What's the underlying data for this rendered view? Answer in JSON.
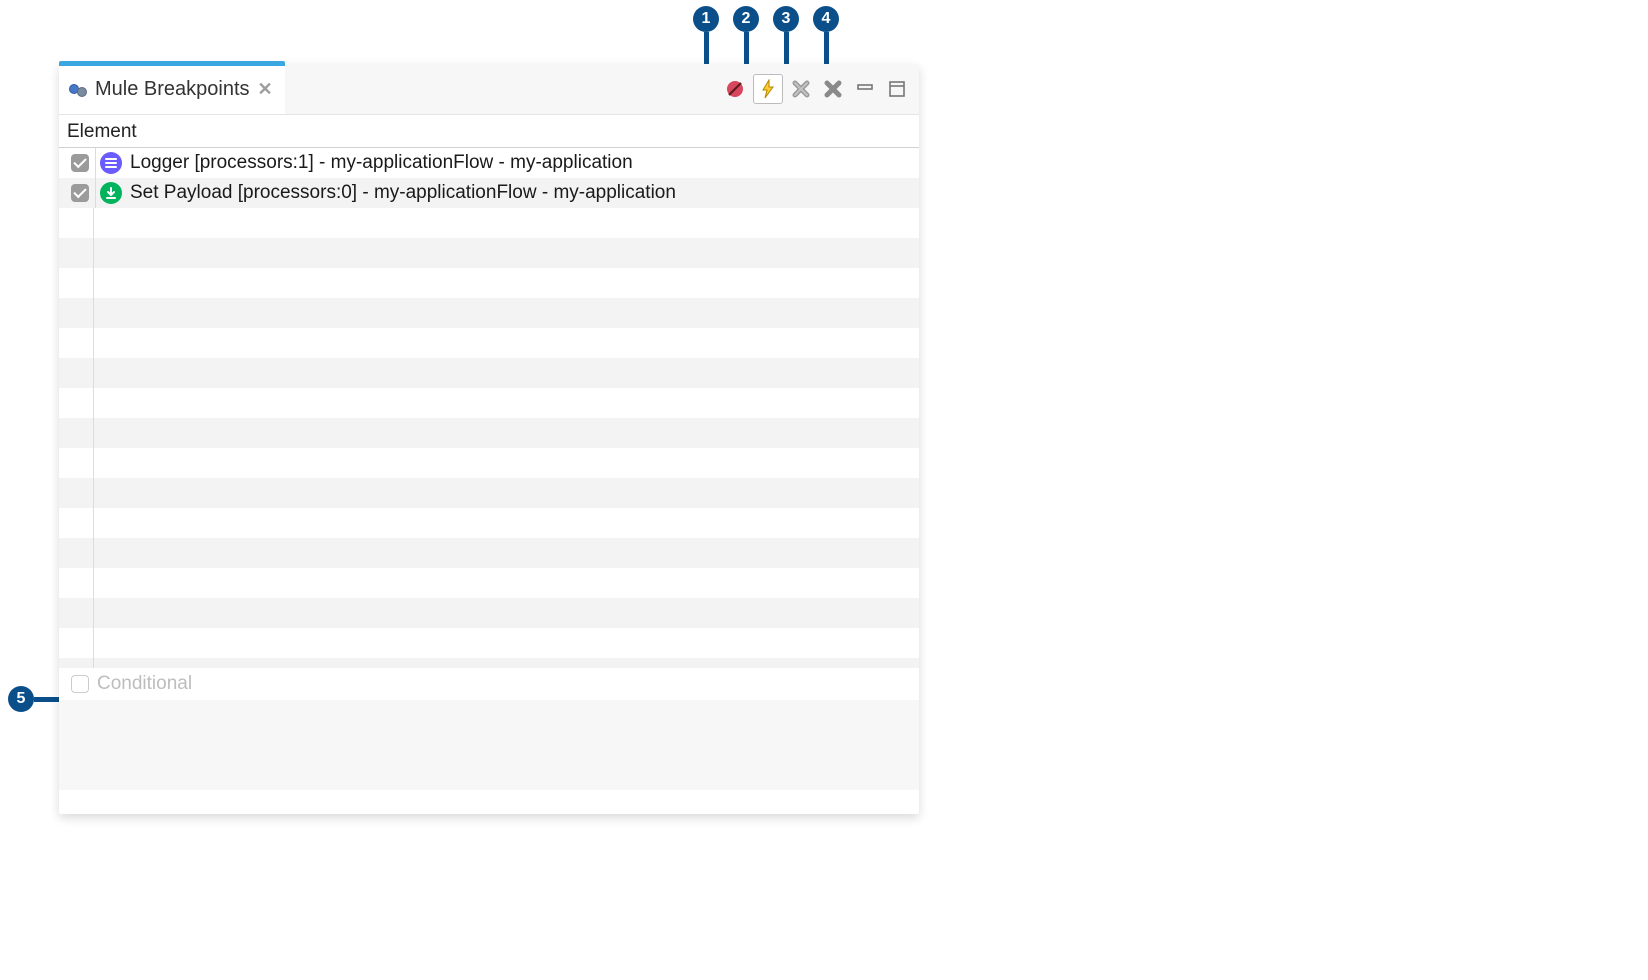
{
  "tab": {
    "title": "Mule Breakpoints"
  },
  "header": {
    "column": "Element"
  },
  "breakpoints": [
    {
      "enabled": true,
      "icon": "logger-icon",
      "label": "Logger [processors:1] - my-applicationFlow - my-application"
    },
    {
      "enabled": true,
      "icon": "set-payload-icon",
      "label": "Set Payload [processors:0] - my-applicationFlow - my-application"
    }
  ],
  "conditional": {
    "label": "Conditional",
    "checked": false
  },
  "callouts": {
    "c1": "1",
    "c2": "2",
    "c3": "3",
    "c4": "4",
    "c5": "5"
  },
  "toolbar_icons": {
    "error_breakpoint": "error-breakpoint-icon",
    "exception_breakpoint": "exception-breakpoint-icon",
    "remove_selected": "remove-selected-icon",
    "remove_all": "remove-all-icon",
    "minimize": "minimize-icon",
    "maximize": "maximize-icon"
  }
}
